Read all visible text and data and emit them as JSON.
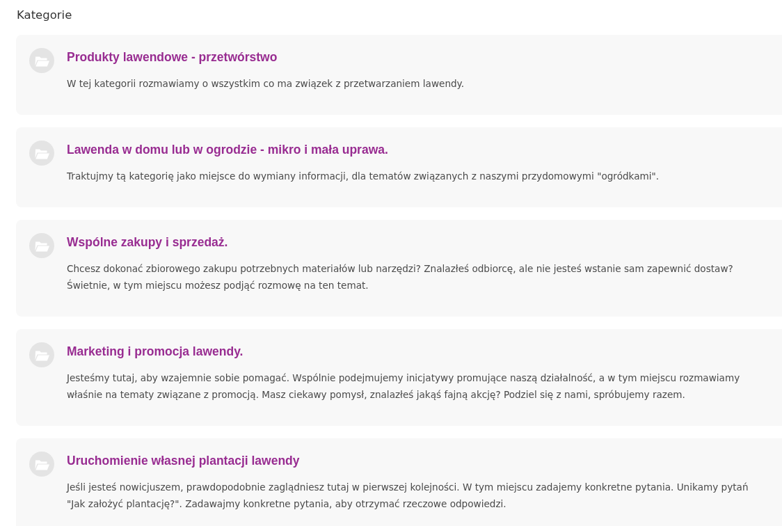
{
  "heading": "Kategorie",
  "categories": [
    {
      "title": "Produkty lawendowe - przetwórstwo",
      "description": "W tej kategorii rozmawiamy o wszystkim co ma związek z przetwarzaniem lawendy."
    },
    {
      "title": "Lawenda w domu lub w ogrodzie - mikro i mała uprawa.",
      "description": "Traktujmy tą kategorię jako miejsce do wymiany informacji, dla tematów związanych z naszymi przydomowymi \"ogródkami\"."
    },
    {
      "title": "Wspólne zakupy i sprzedaż.",
      "description": "Chcesz dokonać zbiorowego zakupu potrzebnych materiałów lub narzędzi? Znalazłeś odbiorcę, ale nie jesteś wstanie sam zapewnić dostaw? Świetnie, w tym miejscu możesz podjąć rozmowę na ten temat."
    },
    {
      "title": "Marketing i promocja lawendy.",
      "description": "Jesteśmy tutaj, aby wzajemnie sobie pomagać. Wspólnie podejmujemy inicjatywy promujące naszą działalność, a w tym miejscu rozmawiamy właśnie na tematy związane z promocją. Masz ciekawy pomysł, znalazłeś jakąś fajną akcję? Podziel się z nami, spróbujemy razem."
    },
    {
      "title": "Uruchomienie własnej plantacji lawendy",
      "description": "Jeśli jesteś nowicjuszem, prawdopodobnie zaglądniesz tutaj w pierwszej kolejności. W tym miejscu zadajemy konkretne pytania. Unikamy pytań \"Jak założyć plantację?\". Zadawajmy konkretne pytania, aby otrzymać rzeczowe odpowiedzi."
    }
  ]
}
